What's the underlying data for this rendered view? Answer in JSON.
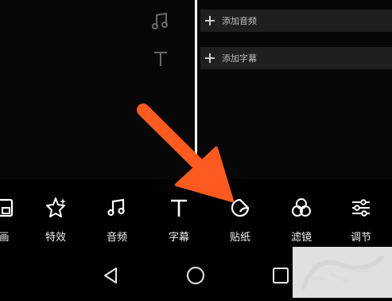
{
  "timeline": {
    "audio_track_icon": "music-note-icon",
    "text_track_icon": "text-T-icon",
    "add_audio_label": "添加音频",
    "add_caption_label": "添加字幕"
  },
  "toolbar": {
    "items": [
      {
        "label": "画",
        "icon": "picture-in-picture-icon"
      },
      {
        "label": "特效",
        "icon": "star-effects-icon"
      },
      {
        "label": "音频",
        "icon": "music-note-icon"
      },
      {
        "label": "字幕",
        "icon": "text-T-icon"
      },
      {
        "label": "贴纸",
        "icon": "sticker-icon"
      },
      {
        "label": "滤镜",
        "icon": "filter-circles-icon"
      },
      {
        "label": "调节",
        "icon": "sliders-icon"
      }
    ]
  },
  "system_nav": {
    "back": "back-triangle-icon",
    "home": "home-circle-icon",
    "recents": "recents-square-icon"
  },
  "colors": {
    "background": "#000000",
    "track_bar": "#1f1f1f",
    "arrow": "#ff5a1f"
  }
}
